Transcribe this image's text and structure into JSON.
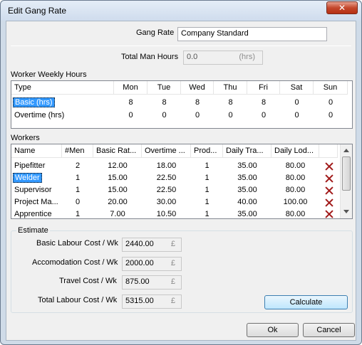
{
  "window": {
    "title": "Edit Gang Rate",
    "close_label": "✕"
  },
  "gang_rate": {
    "label": "Gang Rate",
    "value": "Company Standard"
  },
  "total_man_hours": {
    "label": "Total Man Hours",
    "value": "0.0",
    "unit": "(hrs)"
  },
  "weekly_hours": {
    "section_label": "Worker Weekly Hours",
    "columns": [
      "Type",
      "Mon",
      "Tue",
      "Wed",
      "Thu",
      "Fri",
      "Sat",
      "Sun"
    ],
    "rows": [
      {
        "type": "Basic (hrs)",
        "values": [
          "8",
          "8",
          "8",
          "8",
          "8",
          "0",
          "0"
        ],
        "selected": true
      },
      {
        "type": "Overtime (hrs)",
        "values": [
          "0",
          "0",
          "0",
          "0",
          "0",
          "0",
          "0"
        ],
        "selected": false
      }
    ]
  },
  "workers": {
    "section_label": "Workers",
    "columns": [
      "Name",
      "#Men",
      "Basic Rat...",
      "Overtime ...",
      "Prod...",
      "Daily Tra...",
      "Daily Lod..."
    ],
    "rows": [
      {
        "name": "Pipefitter",
        "men": "2",
        "basic": "12.00",
        "overtime": "18.00",
        "prod": "1",
        "travel": "35.00",
        "lodging": "80.00",
        "selected": false
      },
      {
        "name": "Welder",
        "men": "1",
        "basic": "15.00",
        "overtime": "22.50",
        "prod": "1",
        "travel": "35.00",
        "lodging": "80.00",
        "selected": true
      },
      {
        "name": "Supervisor",
        "men": "1",
        "basic": "15.00",
        "overtime": "22.50",
        "prod": "1",
        "travel": "35.00",
        "lodging": "80.00",
        "selected": false
      },
      {
        "name": "Project Ma...",
        "men": "0",
        "basic": "20.00",
        "overtime": "30.00",
        "prod": "1",
        "travel": "40.00",
        "lodging": "100.00",
        "selected": false
      },
      {
        "name": "Apprentice",
        "men": "1",
        "basic": "7.00",
        "overtime": "10.50",
        "prod": "1",
        "travel": "35.00",
        "lodging": "80.00",
        "selected": false
      }
    ],
    "delete_icon": "delete-x-icon"
  },
  "estimate": {
    "section_label": "Estimate",
    "currency": "£",
    "basic_labour": {
      "label": "Basic Labour Cost / Wk",
      "value": "2440.00"
    },
    "accommodation": {
      "label": "Accomodation Cost / Wk",
      "value": "2000.00"
    },
    "travel": {
      "label": "Travel Cost / Wk",
      "value": "875.00"
    },
    "total_labour": {
      "label": "Total Labour Cost / Wk",
      "value": "5315.00"
    },
    "calculate_label": "Calculate"
  },
  "footer": {
    "ok_label": "Ok",
    "cancel_label": "Cancel"
  },
  "colors": {
    "selection": "#3399ff",
    "delete": "#a11a1a",
    "frame": "#cfdbe8"
  }
}
